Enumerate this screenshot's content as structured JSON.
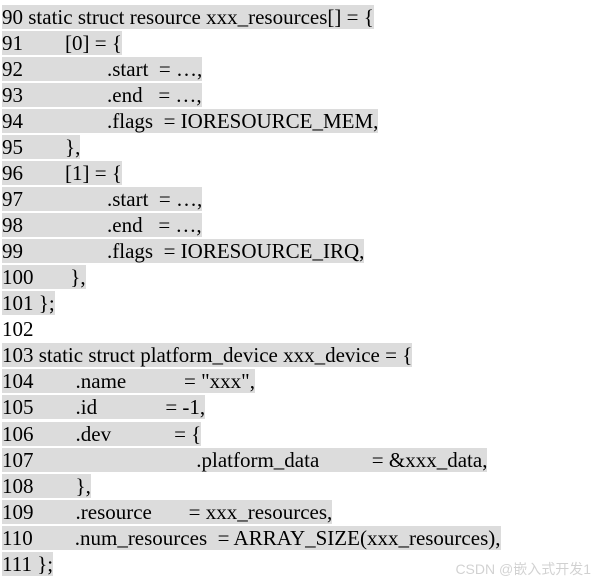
{
  "watermark": "CSDN @嵌入式开发1",
  "lines": [
    {
      "no": "90",
      "text": " static struct resource xxx_resources[] = {",
      "hl": true
    },
    {
      "no": "91",
      "text": "        [0] = {",
      "hl": true
    },
    {
      "no": "92",
      "text": "                .start  = …,",
      "hl": true
    },
    {
      "no": "93",
      "text": "                .end   = …,",
      "hl": true
    },
    {
      "no": "94",
      "text": "                .flags  = IORESOURCE_MEM,",
      "hl": true
    },
    {
      "no": "95",
      "text": "        },",
      "hl": true
    },
    {
      "no": "96",
      "text": "        [1] = {",
      "hl": true
    },
    {
      "no": "97",
      "text": "                .start  = …,",
      "hl": true
    },
    {
      "no": "98",
      "text": "                .end   = …,",
      "hl": true
    },
    {
      "no": "99",
      "text": "                .flags  = IORESOURCE_IRQ,",
      "hl": true
    },
    {
      "no": "100",
      "text": "       },",
      "hl": true
    },
    {
      "no": "101",
      "text": " };",
      "hl": true
    },
    {
      "no": "102",
      "text": "",
      "hl": false
    },
    {
      "no": "103",
      "text": " static struct platform_device xxx_device = {",
      "hl": true
    },
    {
      "no": "104",
      "text": "        .name           = \"xxx\",",
      "hl": true
    },
    {
      "no": "105",
      "text": "        .id             = -1,",
      "hl": true
    },
    {
      "no": "106",
      "text": "        .dev            = {",
      "hl": true
    },
    {
      "no": "107",
      "text": "                               .platform_data          = &xxx_data,",
      "hl": true
    },
    {
      "no": "108",
      "text": "        },",
      "hl": true
    },
    {
      "no": "109",
      "text": "        .resource       = xxx_resources,",
      "hl": true
    },
    {
      "no": "110",
      "text": "        .num_resources  = ARRAY_SIZE(xxx_resources),",
      "hl": true
    },
    {
      "no": "111",
      "text": " };",
      "hl": true
    }
  ]
}
